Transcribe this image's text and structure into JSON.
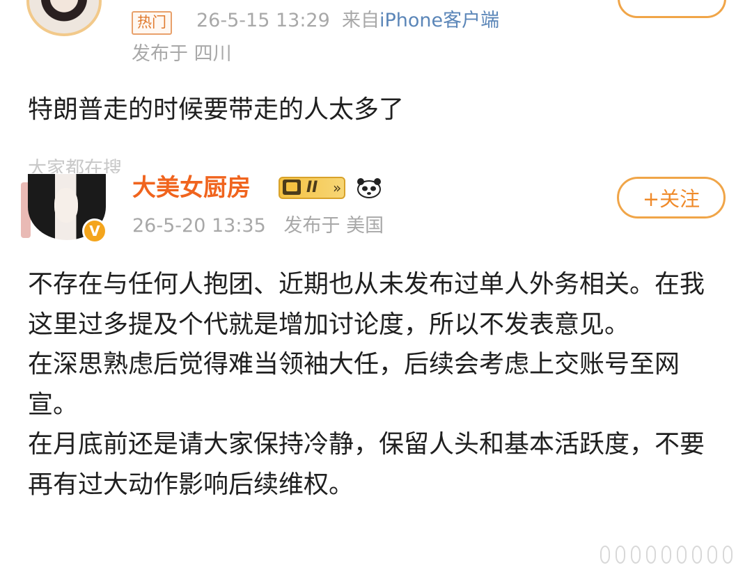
{
  "post1": {
    "hot_label": "热门",
    "time": "26-5-15 13:29",
    "from_prefix": "来自",
    "source": "iPhone客户端",
    "location": "发布于 四川",
    "content": "特朗普走的时候要带走的人太多了"
  },
  "section_label_partial": "大家都在搜",
  "post2": {
    "username": "大美女厨房",
    "level": "II",
    "verified": "V",
    "time": "26-5-20 13:35",
    "location": "发布于 美国",
    "follow_label": "+关注",
    "paragraphs": [
      "不存在与任何人抱团、近期也从未发布过单人外务相关。在我这里过多提及个代就是增加讨论度，所以不发表意见。",
      "在深思熟虑后觉得难当领袖大任，后续会考虑上交账号至网宣。",
      "在月底前还是请大家保持冷静，保留人头和基本活跃度，不要再有过大动作影响后续维权。"
    ]
  },
  "colors": {
    "accent_orange": "#f0641e",
    "follow_border": "#f0a548",
    "meta_gray": "#a8a8a8",
    "link_blue": "#5b86b8"
  }
}
